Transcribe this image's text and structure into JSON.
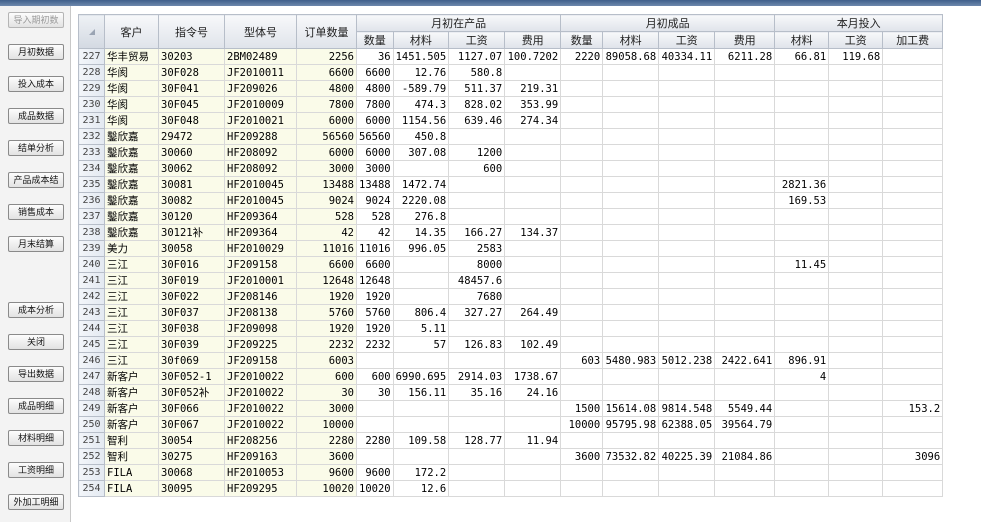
{
  "sidebar": {
    "buttons": [
      {
        "label": "导入期初数",
        "disabled": true
      },
      {
        "label": "月初数据"
      },
      {
        "label": "投入成本"
      },
      {
        "label": "成品数据"
      },
      {
        "label": "结单分析"
      },
      {
        "label": "产品成本结"
      },
      {
        "label": "销售成本"
      },
      {
        "label": "月末结算"
      },
      {
        "label": "成本分析"
      },
      {
        "label": "关闭"
      },
      {
        "label": "导出数据"
      },
      {
        "label": "成品明细"
      },
      {
        "label": "材料明细"
      },
      {
        "label": "工资明细"
      },
      {
        "label": "外加工明细"
      }
    ]
  },
  "grid": {
    "groups": {
      "wip": "月初在产品",
      "finished": "月初成品",
      "input": "本月投入"
    },
    "columns": {
      "customer": "客户",
      "order_no": "指令号",
      "model": "型体号",
      "order_qty": "订单数量",
      "wip": [
        "数量",
        "材料",
        "工资",
        "费用"
      ],
      "finished": [
        "数量",
        "材料",
        "工资",
        "费用"
      ],
      "input": [
        "材料",
        "工资",
        "加工费"
      ]
    },
    "rows": [
      [
        "227",
        "华丰贸易",
        "30203",
        "2BM02489",
        "2256",
        "36",
        "1451.505",
        "1127.07",
        "100.7202",
        "2220",
        "89058.68",
        "40334.11",
        "6211.28",
        "66.81",
        "119.68",
        ""
      ],
      [
        "228",
        "华阂",
        "30F028",
        "JF2010011",
        "6600",
        "6600",
        "12.76",
        "580.8",
        "",
        "",
        "",
        "",
        "",
        "",
        "",
        ""
      ],
      [
        "229",
        "华阂",
        "30F041",
        "JF209026",
        "4800",
        "4800",
        "-589.79",
        "511.37",
        "219.31",
        "",
        "",
        "",
        "",
        "",
        "",
        ""
      ],
      [
        "230",
        "华阂",
        "30F045",
        "JF2010009",
        "7800",
        "7800",
        "474.3",
        "828.02",
        "353.99",
        "",
        "",
        "",
        "",
        "",
        "",
        ""
      ],
      [
        "231",
        "华阂",
        "30F048",
        "JF2010021",
        "6000",
        "6000",
        "1154.56",
        "639.46",
        "274.34",
        "",
        "",
        "",
        "",
        "",
        "",
        ""
      ],
      [
        "232",
        "鑿欣嘉",
        "29472",
        "HF209288",
        "56560",
        "56560",
        "450.8",
        "",
        "",
        "",
        "",
        "",
        "",
        "",
        "",
        ""
      ],
      [
        "233",
        "鑿欣嘉",
        "30060",
        "HF208092",
        "6000",
        "6000",
        "307.08",
        "1200",
        "",
        "",
        "",
        "",
        "",
        "",
        "",
        ""
      ],
      [
        "234",
        "鑿欣嘉",
        "30062",
        "HF208092",
        "3000",
        "3000",
        "",
        "600",
        "",
        "",
        "",
        "",
        "",
        "",
        "",
        ""
      ],
      [
        "235",
        "鑿欣嘉",
        "30081",
        "HF2010045",
        "13488",
        "13488",
        "1472.74",
        "",
        "",
        "",
        "",
        "",
        "",
        "2821.36",
        "",
        ""
      ],
      [
        "236",
        "鑿欣嘉",
        "30082",
        "HF2010045",
        "9024",
        "9024",
        "2220.08",
        "",
        "",
        "",
        "",
        "",
        "",
        "169.53",
        "",
        ""
      ],
      [
        "237",
        "鑿欣嘉",
        "30120",
        "HF209364",
        "528",
        "528",
        "276.8",
        "",
        "",
        "",
        "",
        "",
        "",
        "",
        "",
        ""
      ],
      [
        "238",
        "鑿欣嘉",
        "30121补",
        "HF209364",
        "42",
        "42",
        "14.35",
        "166.27",
        "134.37",
        "",
        "",
        "",
        "",
        "",
        "",
        ""
      ],
      [
        "239",
        "美力",
        "30058",
        "HF2010029",
        "11016",
        "11016",
        "996.05",
        "2583",
        "",
        "",
        "",
        "",
        "",
        "",
        "",
        ""
      ],
      [
        "240",
        "三江",
        "30F016",
        "JF209158",
        "6600",
        "6600",
        "",
        "8000",
        "",
        "",
        "",
        "",
        "",
        "11.45",
        "",
        ""
      ],
      [
        "241",
        "三江",
        "30F019",
        "JF2010001",
        "12648",
        "12648",
        "",
        "48457.6",
        "",
        "",
        "",
        "",
        "",
        "",
        "",
        ""
      ],
      [
        "242",
        "三江",
        "30F022",
        "JF208146",
        "1920",
        "1920",
        "",
        "7680",
        "",
        "",
        "",
        "",
        "",
        "",
        "",
        ""
      ],
      [
        "243",
        "三江",
        "30F037",
        "JF208138",
        "5760",
        "5760",
        "806.4",
        "327.27",
        "264.49",
        "",
        "",
        "",
        "",
        "",
        "",
        ""
      ],
      [
        "244",
        "三江",
        "30F038",
        "JF209098",
        "1920",
        "1920",
        "5.11",
        "",
        "",
        "",
        "",
        "",
        "",
        "",
        "",
        ""
      ],
      [
        "245",
        "三江",
        "30F039",
        "JF209225",
        "2232",
        "2232",
        "57",
        "126.83",
        "102.49",
        "",
        "",
        "",
        "",
        "",
        "",
        ""
      ],
      [
        "246",
        "三江",
        "30f069",
        "JF209158",
        "6003",
        "",
        "",
        "",
        "",
        "603",
        "5480.983",
        "5012.238",
        "2422.641",
        "896.91",
        "",
        ""
      ],
      [
        "247",
        "新客户",
        "30F052-1",
        "JF2010022",
        "600",
        "600",
        "6990.695",
        "2914.03",
        "1738.67",
        "",
        "",
        "",
        "",
        "4",
        "",
        ""
      ],
      [
        "248",
        "新客户",
        "30F052补",
        "JF2010022",
        "30",
        "30",
        "156.11",
        "35.16",
        "24.16",
        "",
        "",
        "",
        "",
        "",
        "",
        ""
      ],
      [
        "249",
        "新客户",
        "30F066",
        "JF2010022",
        "3000",
        "",
        "",
        "",
        "",
        "1500",
        "15614.08",
        "9814.548",
        "5549.44",
        "",
        "",
        "153.2"
      ],
      [
        "250",
        "新客户",
        "30F067",
        "JF2010022",
        "10000",
        "",
        "",
        "",
        "",
        "10000",
        "95795.98",
        "62388.05",
        "39564.79",
        "",
        "",
        ""
      ],
      [
        "251",
        "智利",
        "30054",
        "HF208256",
        "2280",
        "2280",
        "109.58",
        "128.77",
        "11.94",
        "",
        "",
        "",
        "",
        "",
        "",
        ""
      ],
      [
        "252",
        "智利",
        "30275",
        "HF209163",
        "3600",
        "",
        "",
        "",
        "",
        "3600",
        "73532.82",
        "40225.39",
        "21084.86",
        "",
        "",
        "3096"
      ],
      [
        "253",
        "FILA",
        "30068",
        "HF2010053",
        "9600",
        "9600",
        "172.2",
        "",
        "",
        "",
        "",
        "",
        "",
        "",
        "",
        ""
      ],
      [
        "254",
        "FILA",
        "30095",
        "HF209295",
        "10020",
        "10020",
        "12.6",
        "",
        "",
        "",
        "",
        "",
        "",
        "",
        "",
        ""
      ]
    ]
  }
}
